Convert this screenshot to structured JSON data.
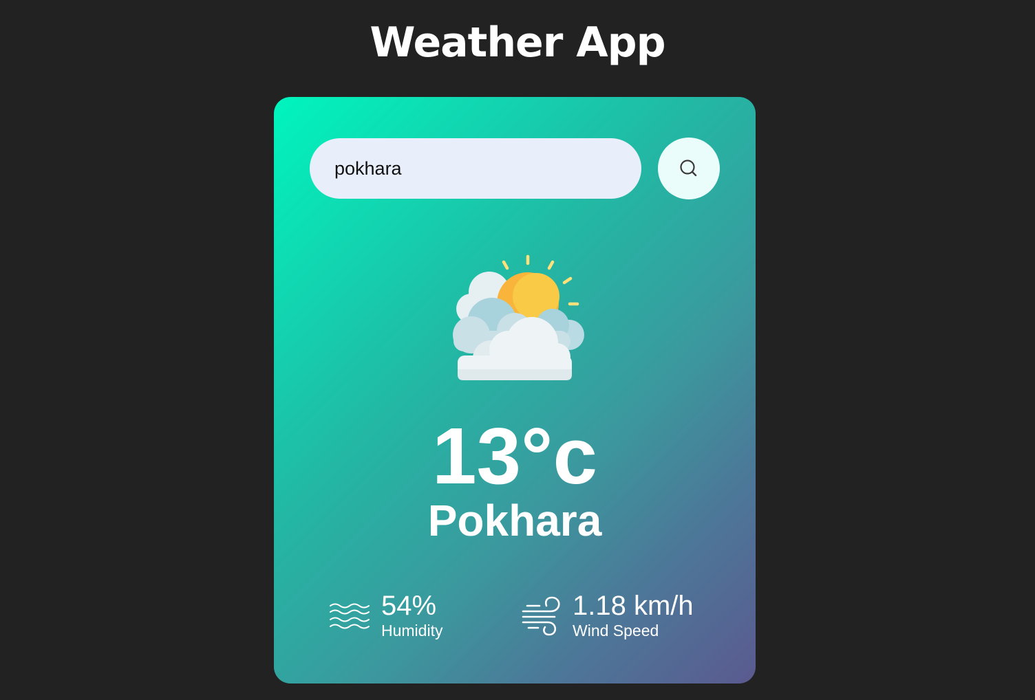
{
  "header": {
    "title": "Weather App"
  },
  "search": {
    "value": "pokhara",
    "button_icon": "search-icon"
  },
  "weather": {
    "icon": "partly-cloudy-icon",
    "temperature": "13°c",
    "city": "Pokhara"
  },
  "details": {
    "humidity": {
      "icon": "humidity-icon",
      "value": "54%",
      "label": "Humidity"
    },
    "wind": {
      "icon": "wind-icon",
      "value": "1.18 km/h",
      "label": "Wind Speed"
    }
  },
  "colors": {
    "background": "#222222",
    "card_gradient_start": "#00f5be",
    "card_gradient_end": "#5b5a90",
    "search_field": "#e8eefa",
    "search_button": "#ebfdfb",
    "text": "#ffffff"
  }
}
